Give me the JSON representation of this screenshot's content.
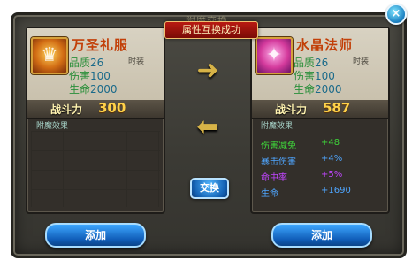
{
  "window": {
    "title": "附魔交换",
    "close_label": "×",
    "banner": "属性互换成功"
  },
  "left_item": {
    "name": "万圣礼服",
    "tag": "时装",
    "stats": [
      {
        "label": "品质",
        "value": "26"
      },
      {
        "label": "伤害",
        "value": "100"
      },
      {
        "label": "生命",
        "value": "2000"
      }
    ],
    "power_label": "战斗力",
    "power_value": "300",
    "effect_header": "附魔效果",
    "effects": []
  },
  "right_item": {
    "name": "水晶法师",
    "tag": "时装",
    "stats": [
      {
        "label": "品质",
        "value": "26"
      },
      {
        "label": "伤害",
        "value": "100"
      },
      {
        "label": "生命",
        "value": "2000"
      }
    ],
    "power_label": "战斗力",
    "power_value": "587",
    "effect_header": "附魔效果",
    "effects": [
      {
        "name": "伤害减免",
        "value": "+48",
        "color": "#3fd63a"
      },
      {
        "name": "暴击伤害",
        "value": "+4%",
        "color": "#4fa6ff"
      },
      {
        "name": "命中率",
        "value": "+5%",
        "color": "#c145ff"
      },
      {
        "name": "生命",
        "value": "+1690",
        "color": "#4fa6ff"
      }
    ]
  },
  "controls": {
    "swap_label": "交换",
    "add_label_left": "添加",
    "add_label_right": "添加"
  },
  "icons": {
    "arrow_right": "right-arrow-icon",
    "arrow_left": "left-arrow-icon",
    "close": "close-icon"
  }
}
